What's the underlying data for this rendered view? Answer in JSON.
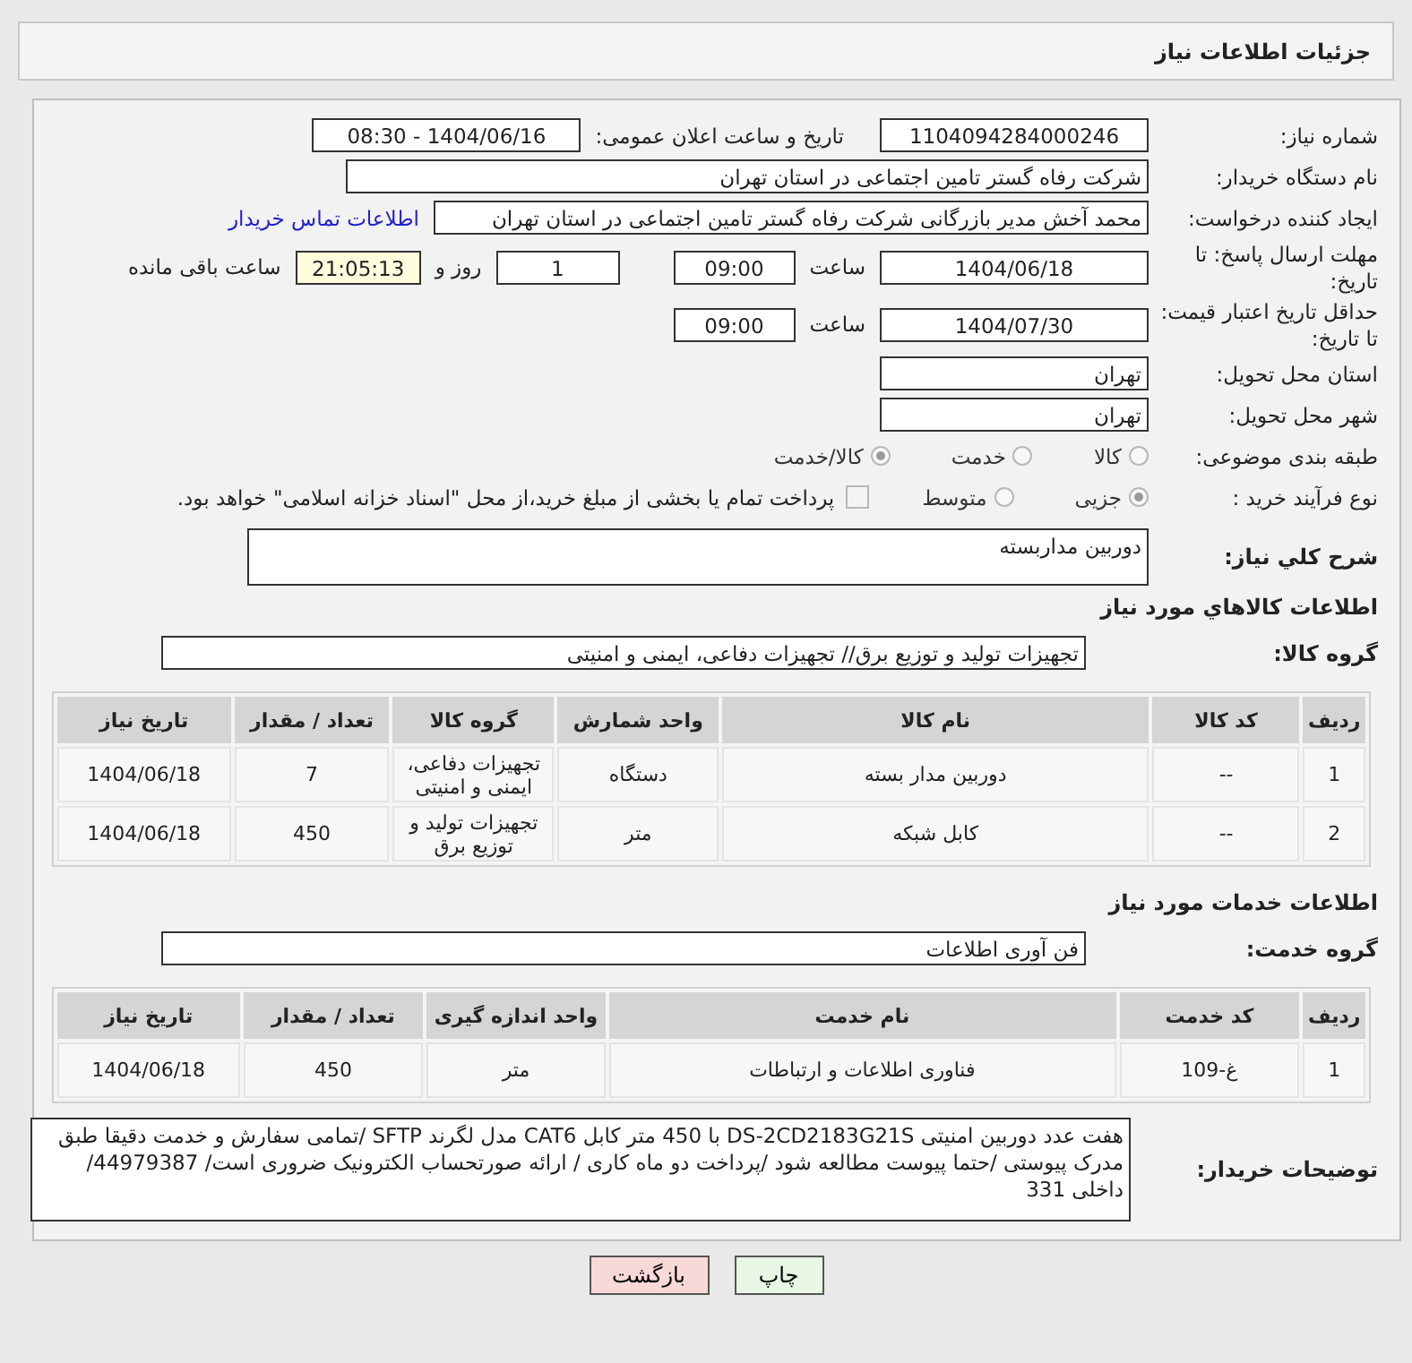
{
  "header": {
    "title": "جزئیات اطلاعات نیاز"
  },
  "need_number": {
    "label": "شماره نیاز:",
    "value": "1104094284000246"
  },
  "announce": {
    "label": "تاریخ و ساعت اعلان عمومی:",
    "value": "1404/06/16 - 08:30"
  },
  "buyer": {
    "label": "نام دستگاه خریدار:",
    "value": "شرکت رفاه گستر تامین اجتماعی در استان تهران"
  },
  "creator": {
    "label": "ایجاد کننده درخواست:",
    "value": "محمد آخش مدیر بازرگانی شرکت رفاه گستر تامین اجتماعی در استان تهران",
    "link": "اطلاعات تماس خریدار"
  },
  "deadline": {
    "label": "مهلت ارسال پاسخ: تا تاریخ:",
    "date": "1404/06/18",
    "time_label": "ساعت",
    "time": "09:00",
    "days": "1",
    "days_label": "روز و",
    "remaining": "21:05:13",
    "remaining_label": "ساعت باقی مانده"
  },
  "validity": {
    "label": "حداقل تاریخ اعتبار قیمت: تا تاریخ:",
    "date": "1404/07/30",
    "time_label": "ساعت",
    "time": "09:00"
  },
  "province": {
    "label": "استان محل تحویل:",
    "value": "تهران"
  },
  "city": {
    "label": "شهر محل تحویل:",
    "value": "تهران"
  },
  "category": {
    "label": "طبقه بندی موضوعی:",
    "options": [
      {
        "label": "کالا",
        "selected": false
      },
      {
        "label": "خدمت",
        "selected": false
      },
      {
        "label": "کالا/خدمت",
        "selected": true
      }
    ]
  },
  "process": {
    "label": "نوع فرآیند خرید :",
    "options": [
      {
        "label": "جزیی",
        "selected": true
      },
      {
        "label": "متوسط",
        "selected": false
      }
    ],
    "payment": {
      "label": "پرداخت تمام یا بخشی از مبلغ خرید،از محل \"اسناد خزانه اسلامی\" خواهد بود.",
      "checked": false
    }
  },
  "summary": {
    "label": "شرح کلي نیاز:",
    "value": "دوربین مداربسته"
  },
  "goods": {
    "heading": "اطلاعات کالاهاي مورد نیاز",
    "group_label": "گروه کالا:",
    "group": "تجهیزات تولید و توزیع برق// تجهیزات دفاعی، ایمنی و امنیتی",
    "columns": [
      "ردیف",
      "کد کالا",
      "نام کالا",
      "واحد شمارش",
      "گروه کالا",
      "تعداد / مقدار",
      "تاریخ نیاز"
    ],
    "rows": [
      [
        "1",
        "--",
        "دوربین مدار بسته",
        "دستگاه",
        "تجهیزات دفاعی، ایمنی و امنیتی",
        "7",
        "1404/06/18"
      ],
      [
        "2",
        "--",
        "کابل شبکه",
        "متر",
        "تجهیزات تولید و توزیع برق",
        "450",
        "1404/06/18"
      ]
    ]
  },
  "services": {
    "heading": "اطلاعات خدمات مورد نیاز",
    "group_label": "گروه خدمت:",
    "group": "فن آوری اطلاعات",
    "columns": [
      "ردیف",
      "کد خدمت",
      "نام خدمت",
      "واحد اندازه گیری",
      "تعداد / مقدار",
      "تاریخ نیاز"
    ],
    "rows": [
      [
        "1",
        "غ-109",
        "فناوری اطلاعات و ارتباطات",
        "متر",
        "450",
        "1404/06/18"
      ]
    ]
  },
  "notes": {
    "label": "توضیحات خریدار:",
    "value": "هفت عدد دوربین امنیتی  DS-2CD2183G21S  با 450 متر کابل CAT6 مدل لگرند SFTP /تمامی سفارش و خدمت دقیقا طبق مدرک پیوستی /حتما پیوست مطالعه شود /پرداخت دو ماه کاری / ارائه صورتحساب الکترونیک ضروری است/ 44979387/ داخلی 331"
  },
  "buttons": [
    {
      "label": "چاپ",
      "kind": "print"
    },
    {
      "label": "بازگشت",
      "kind": "back"
    }
  ]
}
